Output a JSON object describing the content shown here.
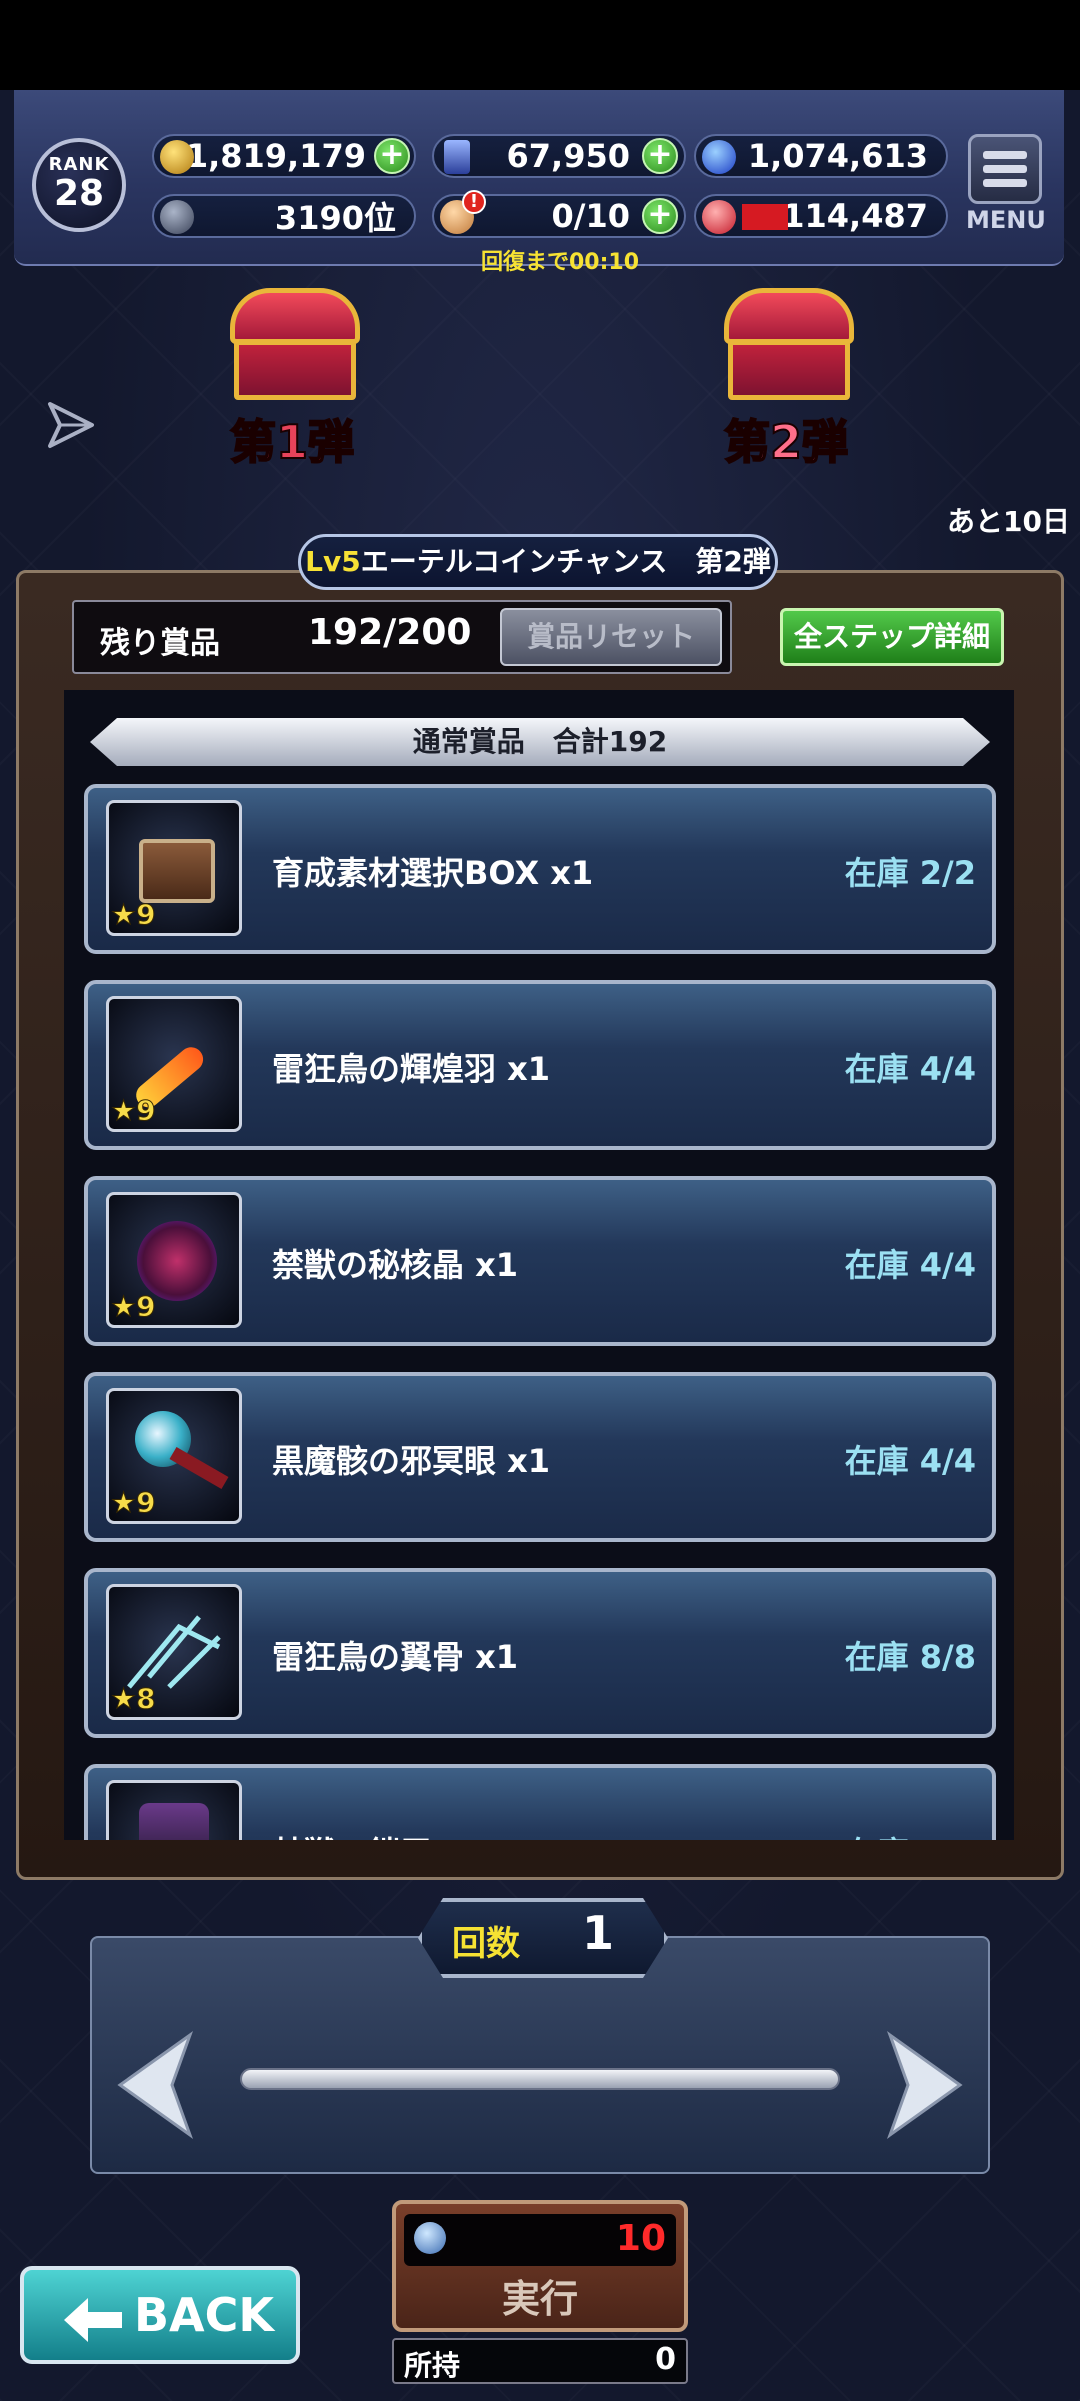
{
  "hud": {
    "rank_label": "RANK",
    "rank_value": "28",
    "gold": "41,819,179",
    "crystals": "67,950",
    "blue_orbs": "1,074,613",
    "ranking": "3190位",
    "stamina": "0/10",
    "red_orbs": "114,487",
    "menu_label": "MENU",
    "recovery": "回復まで00:10"
  },
  "banners": {
    "first_label": "第1弾",
    "second_label": "第2弾",
    "days_left": "あと10日"
  },
  "panel": {
    "title_lv": "Lv5",
    "title_rest": "エーテルコインチャンス　第2弾",
    "remaining_label": "残り賞品",
    "remaining_value": "192/200",
    "reset_button": "賞品リセット",
    "detail_button": "全ステップ詳細",
    "section_title": "通常賞品　合計192"
  },
  "items": [
    {
      "name": "育成素材選択BOX x1",
      "stock": "在庫 2/2",
      "rarity": "★9"
    },
    {
      "name": "雷狂鳥の輝煌羽 x1",
      "stock": "在庫 4/4",
      "rarity": "★9"
    },
    {
      "name": "禁獣の秘核晶 x1",
      "stock": "在庫 4/4",
      "rarity": "★9"
    },
    {
      "name": "黒魔骸の邪冥眼 x1",
      "stock": "在庫 4/4",
      "rarity": "★9"
    },
    {
      "name": "雷狂鳥の翼骨 x1",
      "stock": "在庫 8/8",
      "rarity": "★8"
    },
    {
      "name": "禁獣の鎧甲 x1",
      "stock": "在庫 7/8",
      "rarity": "★8"
    }
  ],
  "counter": {
    "label": "回数",
    "value": "1"
  },
  "execute": {
    "cost": "10",
    "label": "実行",
    "owned_label": "所持",
    "owned_value": "0"
  },
  "back_label": "BACK"
}
